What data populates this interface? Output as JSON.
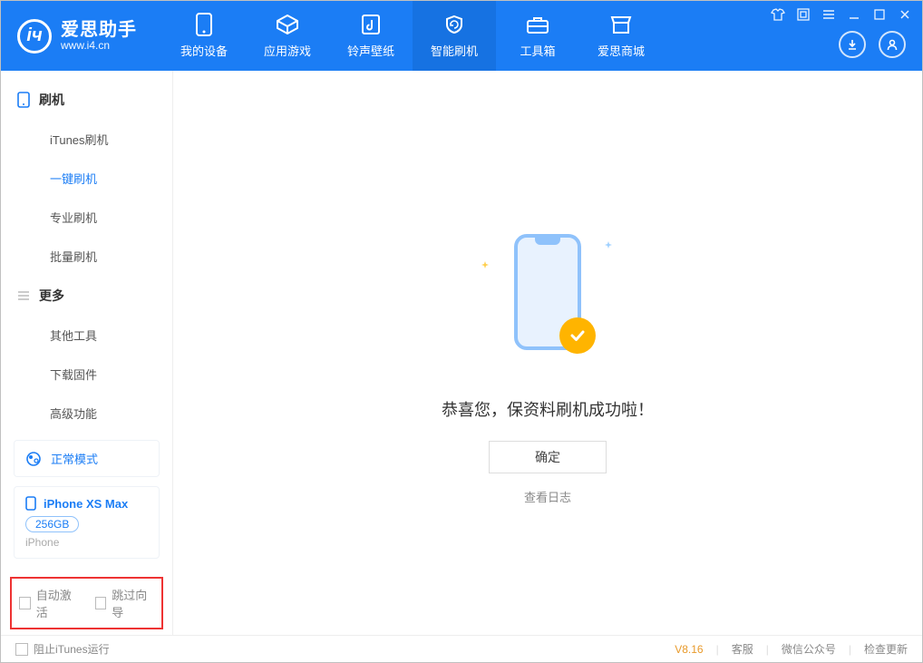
{
  "app": {
    "name": "爱思助手",
    "url": "www.i4.cn"
  },
  "nav": {
    "items": [
      {
        "label": "我的设备"
      },
      {
        "label": "应用游戏"
      },
      {
        "label": "铃声壁纸"
      },
      {
        "label": "智能刷机"
      },
      {
        "label": "工具箱"
      },
      {
        "label": "爱思商城"
      }
    ]
  },
  "sidebar": {
    "group1": {
      "title": "刷机"
    },
    "items1": [
      {
        "label": "iTunes刷机"
      },
      {
        "label": "一键刷机"
      },
      {
        "label": "专业刷机"
      },
      {
        "label": "批量刷机"
      }
    ],
    "group2": {
      "title": "更多"
    },
    "items2": [
      {
        "label": "其他工具"
      },
      {
        "label": "下载固件"
      },
      {
        "label": "高级功能"
      }
    ]
  },
  "mode": {
    "label": "正常模式"
  },
  "device": {
    "name": "iPhone XS Max",
    "storage": "256GB",
    "type": "iPhone"
  },
  "options": {
    "auto_activate": "自动激活",
    "skip_guide": "跳过向导"
  },
  "main": {
    "message": "恭喜您，保资料刷机成功啦！",
    "ok": "确定",
    "view_log": "查看日志"
  },
  "footer": {
    "stop_itunes": "阻止iTunes运行",
    "version": "V8.16",
    "support": "客服",
    "wechat": "微信公众号",
    "check_update": "检查更新"
  }
}
